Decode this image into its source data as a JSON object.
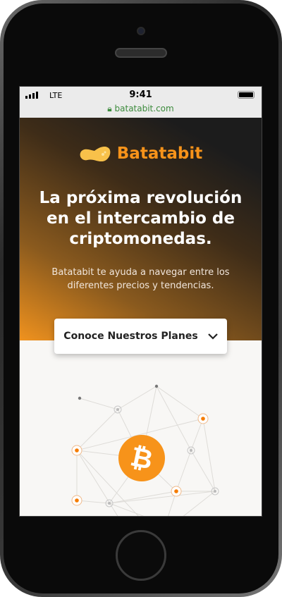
{
  "status_bar": {
    "carrier": "LTE",
    "time": "9:41",
    "url": "batatabit.com"
  },
  "hero": {
    "brand": "Batatabit",
    "title": "La próxima revolución en el intercambio de criptomonedas.",
    "subtitle": "Batatabit te ayuda a navegar entre los diferentes precios y tendencias.",
    "cta_label": "Conoce Nuestros Planes"
  },
  "colors": {
    "accent": "#f7931a",
    "lock": "#3c8b3c"
  }
}
